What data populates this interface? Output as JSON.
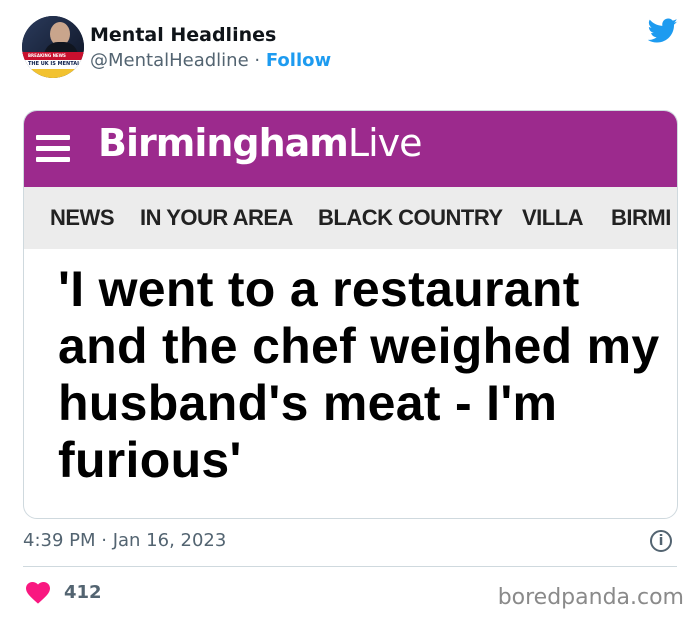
{
  "tweet": {
    "author": {
      "display_name": "Mental Headlines",
      "handle": "@MentalHeadline",
      "separator": "·",
      "follow_label": "Follow",
      "avatar_text_top": "BREAKING NEWS",
      "avatar_text_mid": "THE UK IS MENTAL"
    },
    "timestamp": "4:39 PM · Jan 16, 2023",
    "like_count": "412"
  },
  "article_image": {
    "brand_bold": "Birmingham",
    "brand_light": "Live",
    "nav": [
      "NEWS",
      "IN YOUR AREA",
      "BLACK COUNTRY",
      "VILLA",
      "BIRMI"
    ],
    "headline": "'I went to a restaurant and the chef weighed my husband's meat - I'm furious'"
  },
  "watermark": "boredpanda.com",
  "colors": {
    "brand_purple": "#9c2a8d",
    "twitter_blue": "#1d9bf0",
    "like_red": "#f91880",
    "muted_text": "#536471"
  },
  "icons": {
    "platform": "twitter-bird-icon",
    "menu": "hamburger-menu-icon",
    "info": "info-icon",
    "like": "heart-icon"
  }
}
